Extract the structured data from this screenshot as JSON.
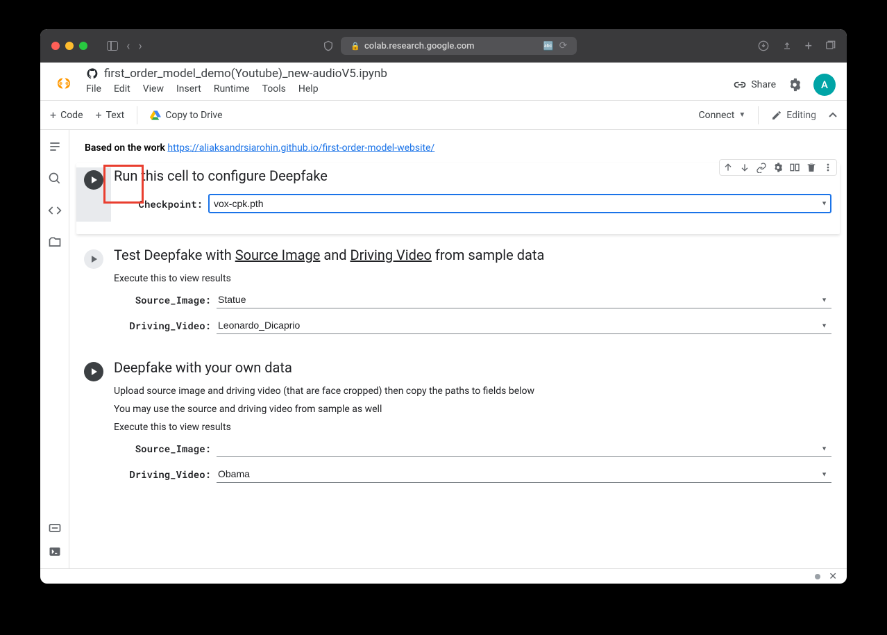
{
  "browser": {
    "url": "colab.research.google.com"
  },
  "notebook": {
    "title": "first_order_model_demo(Youtube)_new-audioV5.ipynb"
  },
  "menu": {
    "file": "File",
    "edit": "Edit",
    "view": "View",
    "insert": "Insert",
    "runtime": "Runtime",
    "tools": "Tools",
    "help": "Help"
  },
  "header": {
    "share": "Share",
    "avatar_letter": "A"
  },
  "toolbar": {
    "code": "Code",
    "text": "Text",
    "copy_drive": "Copy to Drive",
    "connect": "Connect",
    "editing": "Editing"
  },
  "intro": {
    "prefix": "Based on the work ",
    "link": "https://aliaksandrsiarohin.github.io/first-order-model-website/"
  },
  "cell1": {
    "title": "Run this cell to configure Deepfake",
    "checkpoint_label": "Checkpoint:",
    "checkpoint_value": "vox-cpk.pth"
  },
  "cell2": {
    "title_prefix": "Test Deepfake with ",
    "source_image_u": "Source Image",
    "and": " and ",
    "driving_video_u": "Driving Video",
    "title_suffix": " from sample data",
    "subtitle": "Execute this to view results",
    "source_image_label": "Source_Image:",
    "source_image_value": "Statue",
    "driving_video_label": "Driving_Video:",
    "driving_video_value": "Leonardo_Dicaprio"
  },
  "cell3": {
    "title": "Deepfake with your own data",
    "sub1": "Upload source image and driving video (that are face cropped) then copy the paths to fields below",
    "sub2": "You may use the source and driving video from sample as well",
    "sub3": "Execute this to view results",
    "source_image_label": "Source_Image:",
    "source_image_value": "",
    "driving_video_label": "Driving_Video:",
    "driving_video_value": "Obama"
  }
}
